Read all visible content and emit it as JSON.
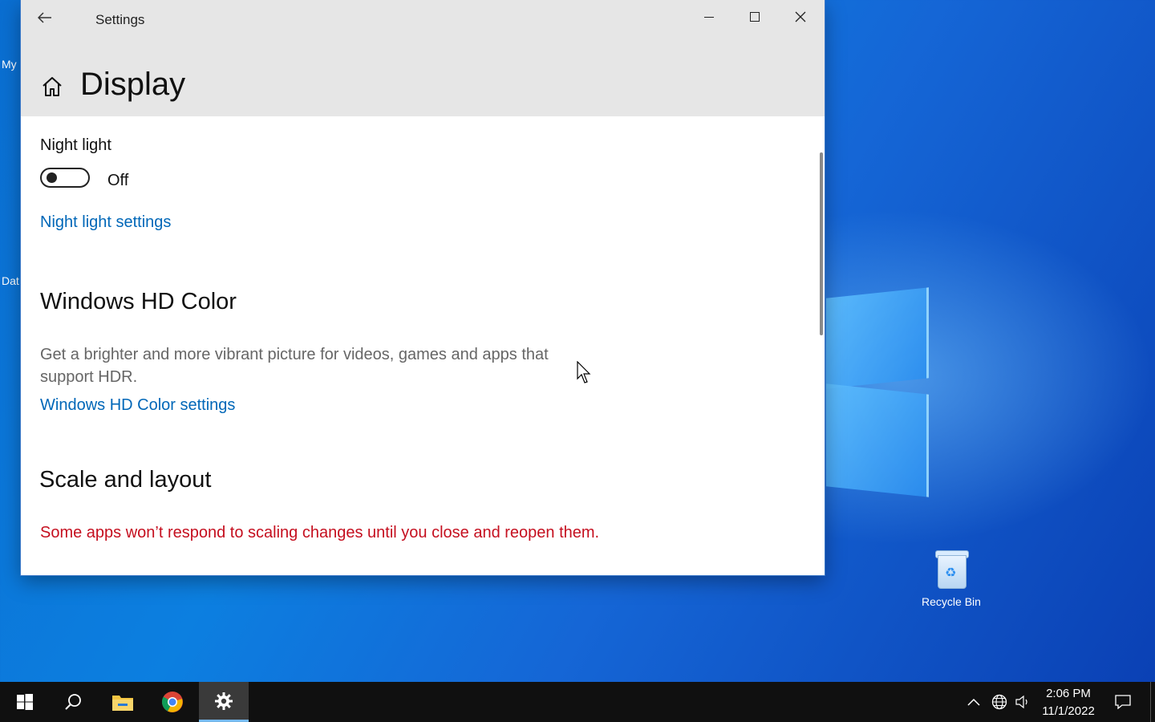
{
  "window": {
    "title": "Settings",
    "page_title": "Display"
  },
  "night_light": {
    "label": "Night light",
    "toggle_state": "Off",
    "settings_link": "Night light settings"
  },
  "hd_color": {
    "heading": "Windows HD Color",
    "description": "Get a brighter and more vibrant picture for videos, games and apps that support HDR.",
    "settings_link": "Windows HD Color settings"
  },
  "scale_layout": {
    "heading": "Scale and layout",
    "warning": "Some apps won’t respond to scaling changes until you close and reopen them."
  },
  "desktop": {
    "recycle_bin_label": "Recycle Bin",
    "partial_icon_labels": [
      "My",
      "Dat"
    ]
  },
  "taskbar": {
    "time": "2:06 PM",
    "date": "11/1/2022",
    "apps": [
      "start-icon",
      "search-icon",
      "file-explorer-icon",
      "chrome-icon",
      "settings-icon"
    ]
  },
  "colors": {
    "link": "#0067b8",
    "warning": "#c50f1f",
    "accent": "#76b9ed"
  }
}
